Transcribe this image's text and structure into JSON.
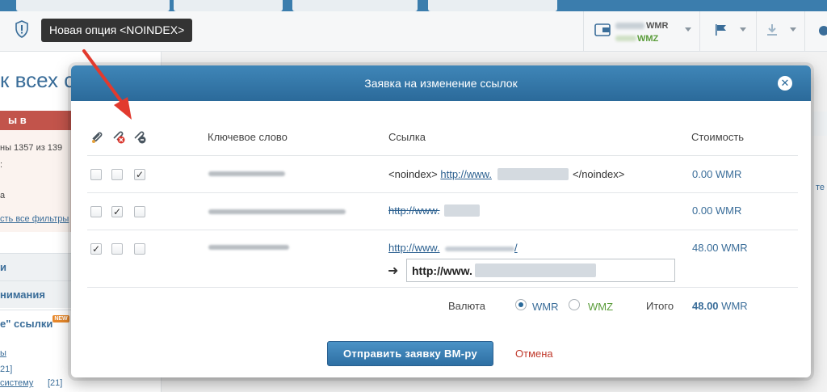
{
  "tooltip": "Новая опция <NOINDEX>",
  "toolbar": {
    "wmr": "WMR",
    "wmz": "WMZ"
  },
  "left": {
    "title": "к всех с",
    "red_tab": "ы в таблице",
    "line1": "ны 1357 из 139",
    "line2": ":",
    "line3": "а",
    "reset": "сть все фильтры",
    "head1": "и",
    "head2": "нимания",
    "head3": "е\" ссылки",
    "new_badge": "NEW",
    "link1": "ы",
    "count1": "21]",
    "link2": "системы",
    "link2_text": " систему",
    "count2": "[21]"
  },
  "right_bg": "те",
  "modal": {
    "title": "Заявка на изменение ссылок",
    "close": "✕",
    "columns": {
      "keyword": "Ключевое слово",
      "link": "Ссылка",
      "cost": "Стоимость"
    },
    "icons": [
      "link-icon",
      "link-remove-icon",
      "link-noindex-icon"
    ],
    "rows": [
      {
        "checks": [
          false,
          false,
          true
        ],
        "link_pre": "<noindex>",
        "link": "http://www.",
        "link_post": "</noindex>",
        "price": "0.00 WMR"
      },
      {
        "checks": [
          false,
          true,
          false
        ],
        "link": "http://www.",
        "link_tail": "",
        "price": "0.00 WMR"
      },
      {
        "checks": [
          true,
          false,
          false
        ],
        "link": "http://www.",
        "link_tail": "/",
        "price": "48.00 WMR",
        "new_url": "http://www.                                f"
      }
    ],
    "currency_label": "Валюта",
    "currency_options": [
      "WMR",
      "WMZ"
    ],
    "currency_selected": "WMR",
    "total_label": "Итого",
    "total_value": "48.00",
    "total_unit": "WMR",
    "submit": "Отправить заявку ВМ-ру",
    "cancel": "Отмена"
  },
  "colors": {
    "accent": "#2b6a9a",
    "cancel": "#c0392b",
    "wmz": "#5a9c3a",
    "arrow": "#e23a2e"
  }
}
